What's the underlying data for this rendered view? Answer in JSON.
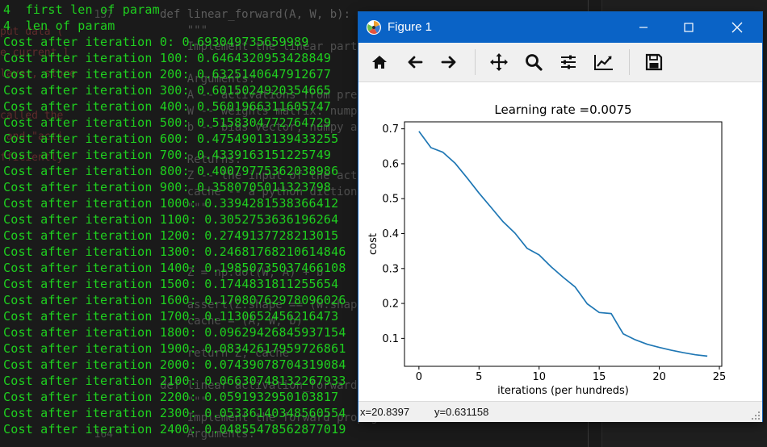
{
  "terminal": {
    "lines": [
      "4  first len of param",
      "4  len of param",
      "Cost after iteration 0: 0.693049735659989",
      "Cost after iteration 100: 0.6464320953428849",
      "Cost after iteration 200: 0.6325140647912677",
      "Cost after iteration 300: 0.6015024920354665",
      "Cost after iteration 400: 0.5601966311605747",
      "Cost after iteration 500: 0.5158304772764729",
      "Cost after iteration 600: 0.47549013139433255",
      "Cost after iteration 700: 0.4339163151225749",
      "Cost after iteration 800: 0.40079775362038986",
      "Cost after iteration 900: 0.3580705011323798",
      "Cost after iteration 1000: 0.3394281538366412",
      "Cost after iteration 1100: 0.3052753636196264",
      "Cost after iteration 1200: 0.2749137728213015",
      "Cost after iteration 1300: 0.24681768210614846",
      "Cost after iteration 1400: 0.19850735037466108",
      "Cost after iteration 1500: 0.1744831811255654",
      "Cost after iteration 1600: 0.17080762978096026",
      "Cost after iteration 1700: 0.1130652456216473",
      "Cost after iteration 1800: 0.09629426845937154",
      "Cost after iteration 1900: 0.08342617959726861",
      "Cost after iteration 2000: 0.07439078704319084",
      "Cost after iteration 2100: 0.06630748132267933",
      "Cost after iteration 2200: 0.0591932950103817",
      "Cost after iteration 2300: 0.05336140348560554",
      "Cost after iteration 2400: 0.04855478562877019"
    ]
  },
  "editor": {
    "gutter_numbers": [
      "137",
      "",
      "",
      "",
      "",
      "",
      "",
      "",
      "",
      "",
      "",
      "",
      "",
      "",
      "",
      "",
      "",
      "",
      "",
      "",
      "",
      "",
      "",
      "",
      "",
      "",
      "164"
    ],
    "code_lines": [
      "def linear_forward(A, W, b):",
      "    \"\"\"",
      "    Implement the linear part of a layer's",
      "",
      "    Arguments:",
      "    A -- activations from previous layer",
      "    W -- weights matrix: numpy array",
      "    b -- bias vector, numpy array of",
      "",
      "    Returns:",
      "    Z -- the input of the activation",
      "    cache -- a python dictionary containing",
      "    \"\"\"",
      "",
      "",
      "",
      "    Z = np.dot(W, A) + b",
      "",
      "    assert(Z.shape == (W.shape[0], A",
      "    cache = (A, W, b)",
      "",
      "    return Z, cache",
      "",
      "def linear_activation_forward(A_prev",
      "    \"\"\"",
      "    Implement the forward propagation",
      "    Arguments:"
    ],
    "ghost_lines": [
      "put data (",
      "e current l",
      "layer, store",
      "",
      "called the",
      " and \"acti",
      "fficiently"
    ]
  },
  "figure_window": {
    "title": "Figure 1",
    "toolbar": [
      {
        "name": "home-icon",
        "label": "Home"
      },
      {
        "name": "back-arrow-icon",
        "label": "Back"
      },
      {
        "name": "forward-arrow-icon",
        "label": "Forward"
      },
      {
        "name": "pan-icon",
        "label": "Pan"
      },
      {
        "name": "zoom-icon",
        "label": "Zoom"
      },
      {
        "name": "configure-subplots-icon",
        "label": "Subplots"
      },
      {
        "name": "edit-axis-icon",
        "label": "Customize"
      },
      {
        "name": "save-icon",
        "label": "Save"
      }
    ],
    "status": {
      "x_readout": "x=20.8397",
      "y_readout": "y=0.631158"
    }
  },
  "chart_data": {
    "type": "line",
    "title": "Learning rate =0.0075",
    "xlabel": "iterations (per hundreds)",
    "ylabel": "cost",
    "xlim": [
      -1.2,
      25.2
    ],
    "ylim": [
      0.02,
      0.72
    ],
    "xticks": [
      0,
      5,
      10,
      15,
      20,
      25
    ],
    "yticks": [
      0.1,
      0.2,
      0.3,
      0.4,
      0.5,
      0.6,
      0.7
    ],
    "grid": false,
    "color": "#1f77b4",
    "x": [
      0,
      1,
      2,
      3,
      4,
      5,
      6,
      7,
      8,
      9,
      10,
      11,
      12,
      13,
      14,
      15,
      16,
      17,
      18,
      19,
      20,
      21,
      22,
      23,
      24
    ],
    "series": [
      {
        "values": [
          0.693,
          0.646,
          0.633,
          0.602,
          0.56,
          0.516,
          0.475,
          0.434,
          0.401,
          0.358,
          0.339,
          0.305,
          0.275,
          0.247,
          0.199,
          0.174,
          0.171,
          0.113,
          0.096,
          0.083,
          0.074,
          0.066,
          0.059,
          0.053,
          0.049
        ]
      }
    ]
  }
}
